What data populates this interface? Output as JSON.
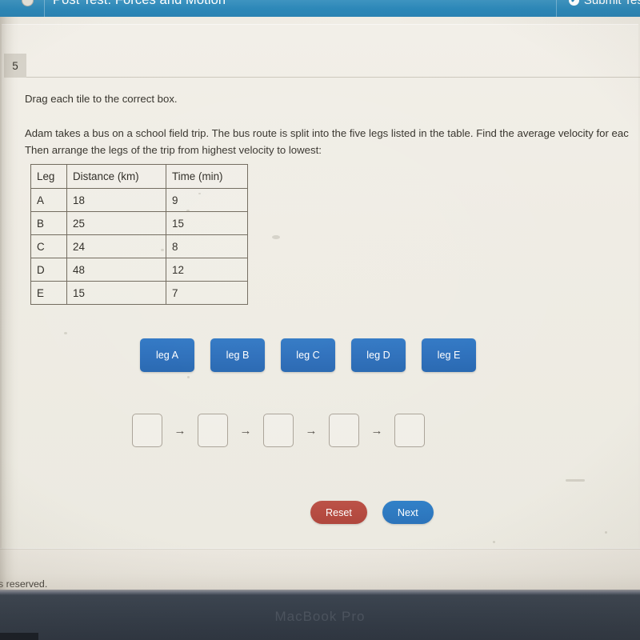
{
  "header": {
    "title": "Post Test: Forces and Motion",
    "submit_label": "Submit Test",
    "check_glyph": "✔",
    "bar_color": "#2b87b8"
  },
  "question": {
    "number": "5",
    "instruction": "Drag each tile to the correct box.",
    "prompt_line1": "Adam takes a bus on a school field trip. The bus route is split into the five legs listed in the table. Find the average velocity for eac",
    "prompt_line2": "Then arrange the legs of the trip from highest velocity to lowest:"
  },
  "table": {
    "headers": [
      "Leg",
      "Distance (km)",
      "Time (min)"
    ],
    "rows": [
      [
        "A",
        "18",
        "9"
      ],
      [
        "B",
        "25",
        "15"
      ],
      [
        "C",
        "24",
        "8"
      ],
      [
        "D",
        "48",
        "12"
      ],
      [
        "E",
        "15",
        "7"
      ]
    ]
  },
  "tiles": [
    {
      "label": "leg A"
    },
    {
      "label": "leg B"
    },
    {
      "label": "leg C"
    },
    {
      "label": "leg D"
    },
    {
      "label": "leg E"
    }
  ],
  "dropzones": [
    {
      "value": ""
    },
    {
      "value": ""
    },
    {
      "value": ""
    },
    {
      "value": ""
    },
    {
      "value": ""
    }
  ],
  "arrow_glyph": "→",
  "buttons": {
    "reset_label": "Reset",
    "reset_color": "#b0463c",
    "next_label": "Next",
    "next_color": "#2b73ba"
  },
  "footer": {
    "text": "ights reserved."
  },
  "device": {
    "brand": "MacBook Pro"
  }
}
